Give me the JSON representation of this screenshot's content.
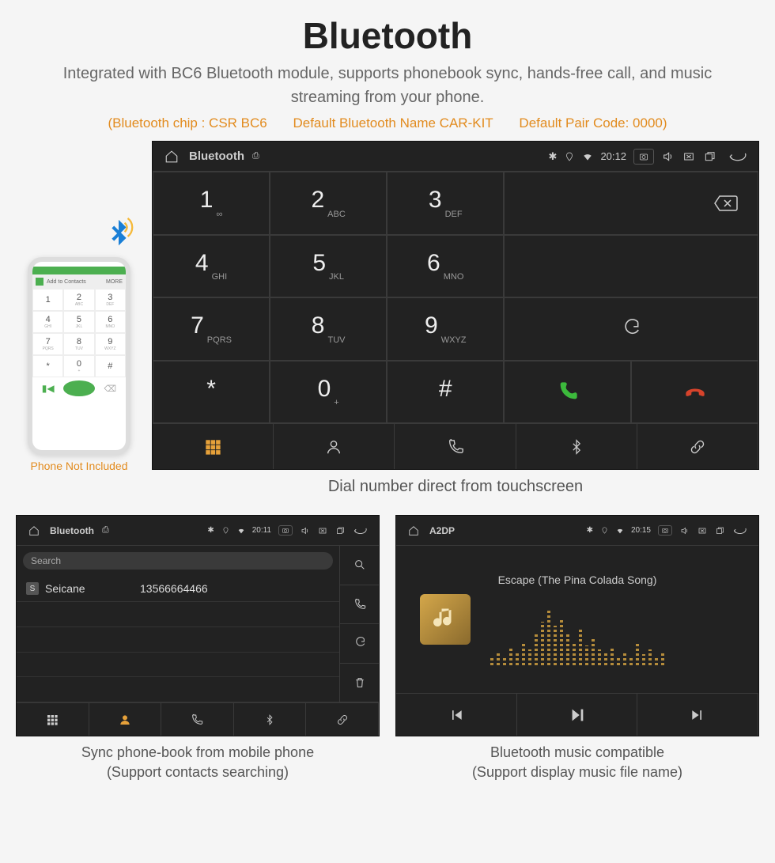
{
  "title": "Bluetooth",
  "subtitle": "Integrated with BC6 Bluetooth module, supports phonebook sync, hands-free call, and music streaming from your phone.",
  "specs": {
    "chip": "(Bluetooth chip : CSR BC6",
    "name": "Default Bluetooth Name CAR-KIT",
    "code": "Default Pair Code: 0000)"
  },
  "phone_caption": "Phone Not Included",
  "phone_mock": {
    "header": "Add to Contacts",
    "header_right": "MORE",
    "keys": [
      {
        "n": "1",
        "s": ""
      },
      {
        "n": "2",
        "s": "ABC"
      },
      {
        "n": "3",
        "s": "DEF"
      },
      {
        "n": "4",
        "s": "GHI"
      },
      {
        "n": "5",
        "s": "JKL"
      },
      {
        "n": "6",
        "s": "MNO"
      },
      {
        "n": "7",
        "s": "PQRS"
      },
      {
        "n": "8",
        "s": "TUV"
      },
      {
        "n": "9",
        "s": "WXYZ"
      },
      {
        "n": "*",
        "s": ""
      },
      {
        "n": "0",
        "s": "+"
      },
      {
        "n": "#",
        "s": ""
      }
    ]
  },
  "main_panel": {
    "app": "Bluetooth",
    "time": "20:12",
    "keys": [
      [
        {
          "n": "1",
          "s": "∞"
        },
        {
          "n": "2",
          "s": "ABC"
        },
        {
          "n": "3",
          "s": "DEF"
        }
      ],
      [
        {
          "n": "4",
          "s": "GHI"
        },
        {
          "n": "5",
          "s": "JKL"
        },
        {
          "n": "6",
          "s": "MNO"
        }
      ],
      [
        {
          "n": "7",
          "s": "PQRS"
        },
        {
          "n": "8",
          "s": "TUV"
        },
        {
          "n": "9",
          "s": "WXYZ"
        }
      ],
      [
        {
          "n": "*",
          "s": ""
        },
        {
          "n": "0",
          "s": "+"
        },
        {
          "n": "#",
          "s": ""
        }
      ]
    ],
    "caption": "Dial number direct from touchscreen"
  },
  "contacts_panel": {
    "app": "Bluetooth",
    "time": "20:11",
    "search_placeholder": "Search",
    "contact_badge": "S",
    "contact_name": "Seicane",
    "contact_number": "13566664466",
    "caption_line1": "Sync phone-book from mobile phone",
    "caption_line2": "(Support contacts searching)"
  },
  "a2dp_panel": {
    "app": "A2DP",
    "time": "20:15",
    "song": "Escape (The Pina Colada Song)",
    "caption_line1": "Bluetooth music compatible",
    "caption_line2": "(Support display music file name)"
  }
}
